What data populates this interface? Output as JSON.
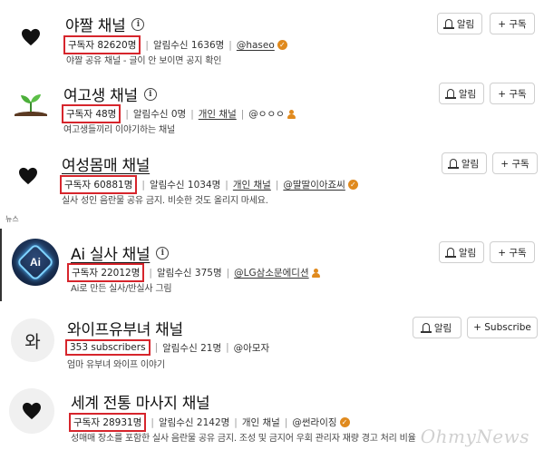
{
  "section_label": "뉴스",
  "watermark": "OhmyNews",
  "channels": [
    {
      "title": "야짤 채널",
      "subs": "구독자 82620명",
      "alerts": "알림수신 1636명",
      "type": "",
      "handle": "@haseo",
      "desc": "야짤 공유 채널 - 글이 안 보이면 공지 확인",
      "alarm_label": "알림",
      "subscribe_label": "+ 구독"
    },
    {
      "title": "여고생 채널",
      "subs": "구독자 48명",
      "alerts": "알림수신 0명",
      "type": "개인 채널",
      "handle": "@ㅇㅇㅇ",
      "desc": "여고생들끼리 이야기하는 채널",
      "alarm_label": "알림",
      "subscribe_label": "+ 구독"
    },
    {
      "title": "여성몸매 채널",
      "subs": "구독자 60881명",
      "alerts": "알림수신 1034명",
      "type": "개인 채널",
      "handle": "@딸딸이아죠씨",
      "desc": "실사 성인 음란물 공유 금지. 비슷한 것도 올리지 마세요.",
      "alarm_label": "알림",
      "subscribe_label": "+ 구독"
    },
    {
      "title": "Ai 실사 채널",
      "subs": "구독자 22012명",
      "alerts": "알림수신 375명",
      "type": "",
      "handle": "@LG삼소문에디션",
      "desc": "Ai로 만든 실사/반실사 그림",
      "alarm_label": "알림",
      "subscribe_label": "+ 구독",
      "avatar_text": "Ai"
    },
    {
      "title": "와이프유부녀 채널",
      "subs": "353 subscribers",
      "alerts": "알림수신 21명",
      "type": "",
      "handle": "@아모자",
      "desc": "엄마 유부녀 와이프 이야기",
      "alarm_label": "알림",
      "subscribe_label": "+ Subscribe",
      "avatar_text": "와"
    },
    {
      "title": "세계 전통 마사지 채널",
      "subs": "구독자 28931명",
      "alerts": "알림수신 2142명",
      "type": "개인 채널",
      "handle": "@썬라이징",
      "desc": "성매매 장소를 포함한 실사 음란물 공유 금지. 조성 및 금지어 우회 관리자 재량 경고 처리 비율",
      "alarm_label": "알림",
      "subscribe_label": "+ 구독"
    }
  ]
}
